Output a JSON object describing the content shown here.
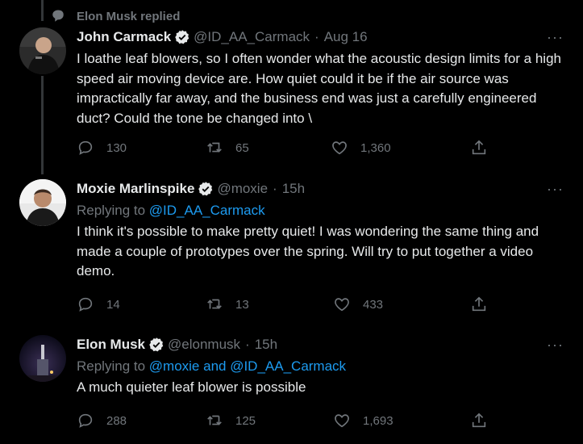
{
  "social_context": {
    "label": "Elon Musk replied",
    "icon": "speech-bubble-icon"
  },
  "tweets": [
    {
      "name": "John Carmack",
      "handle": "@ID_AA_Carmack",
      "sep": "·",
      "time": "Aug 16",
      "replying_prefix": "",
      "replying_to": "",
      "text": "I loathe leaf blowers, so I often wonder what the acoustic design limits for a high speed air moving device are. How quiet could it be if the air source was impractically far away, and the business end was just a carefully engineered duct? Could the tone be changed into \\",
      "replies": "130",
      "retweets": "65",
      "likes": "1,360"
    },
    {
      "name": "Moxie Marlinspike",
      "handle": "@moxie",
      "sep": "·",
      "time": "15h",
      "replying_prefix": "Replying to ",
      "replying_to": "@ID_AA_Carmack",
      "text": "I think it's possible to make pretty quiet! I was wondering the same thing and made a couple of prototypes over the spring. Will try to put together a video demo.",
      "replies": "14",
      "retweets": "13",
      "likes": "433"
    },
    {
      "name": "Elon Musk",
      "handle": "@elonmusk",
      "sep": "·",
      "time": "15h",
      "replying_prefix": "Replying to ",
      "replying_to": "@moxie and @ID_AA_Carmack",
      "text": "A much quieter leaf blower is possible",
      "replies": "288",
      "retweets": "125",
      "likes": "1,693"
    }
  ],
  "more_label": "···",
  "colors": {
    "background": "#000000",
    "text": "#e7e9ea",
    "muted": "#71767b",
    "link": "#1d9bf0",
    "verified": "#1d9bf0"
  }
}
